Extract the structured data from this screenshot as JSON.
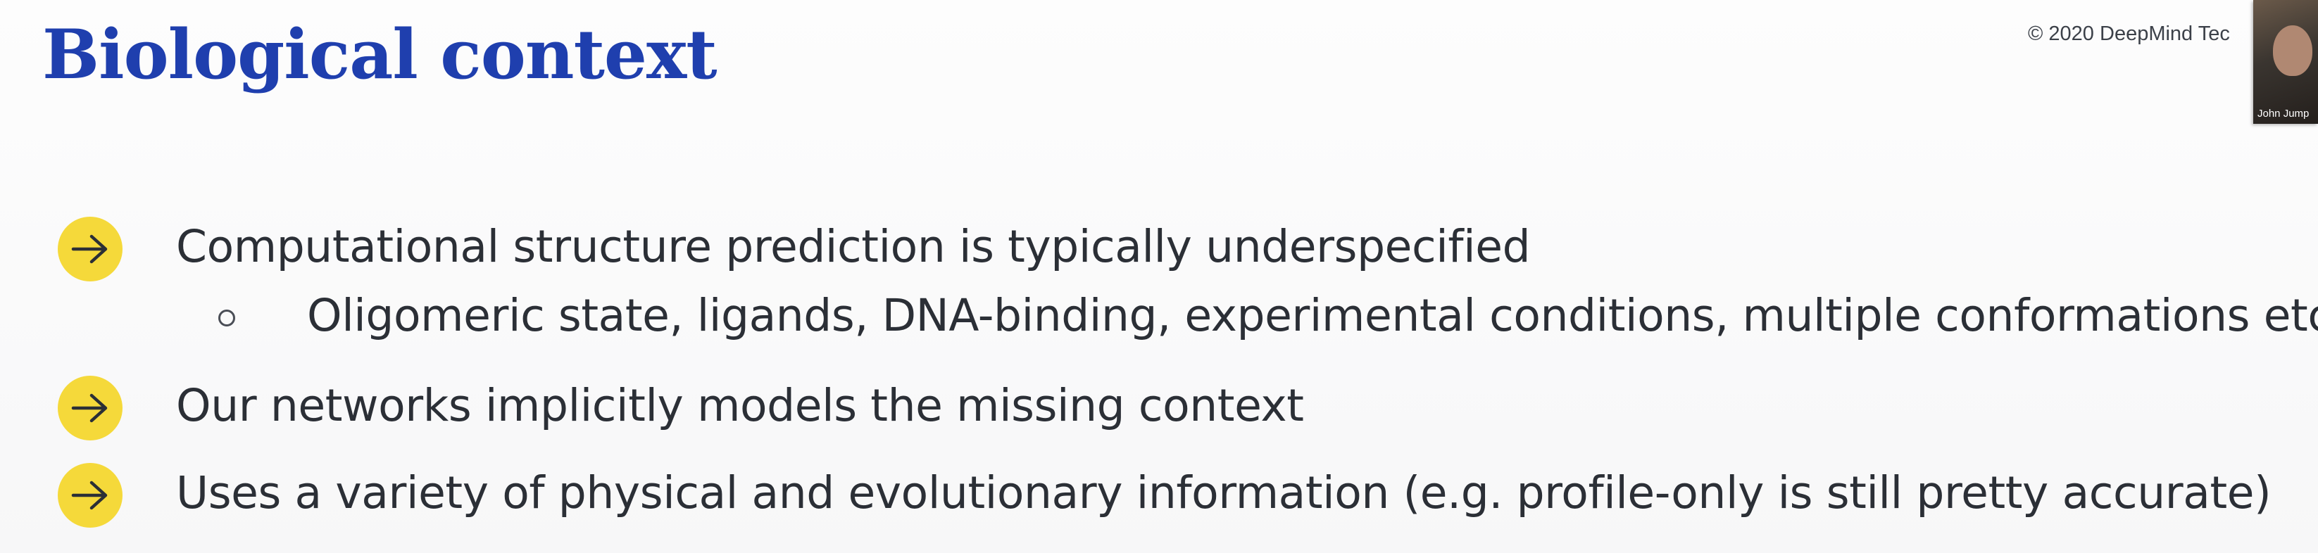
{
  "slide": {
    "title": "Biological context",
    "copyright": "© 2020 DeepMind Tec",
    "bullets": [
      {
        "text": "Computational structure prediction is typically underspecified"
      },
      {
        "text": "Oligomeric state, ligands, DNA-binding, experimental conditions, multiple conformations etc."
      },
      {
        "text": "Our networks implicitly models the missing context"
      },
      {
        "text": "Uses a variety of physical and evolutionary information (e.g. profile-only is still pretty accurate)"
      }
    ],
    "bullet_icon": "right-arrow-icon",
    "sub_bullet_icon": "hollow-circle-icon",
    "accent_color": "#f5d93a",
    "title_color": "#1f3fae"
  },
  "participant": {
    "name": "John Jump"
  }
}
